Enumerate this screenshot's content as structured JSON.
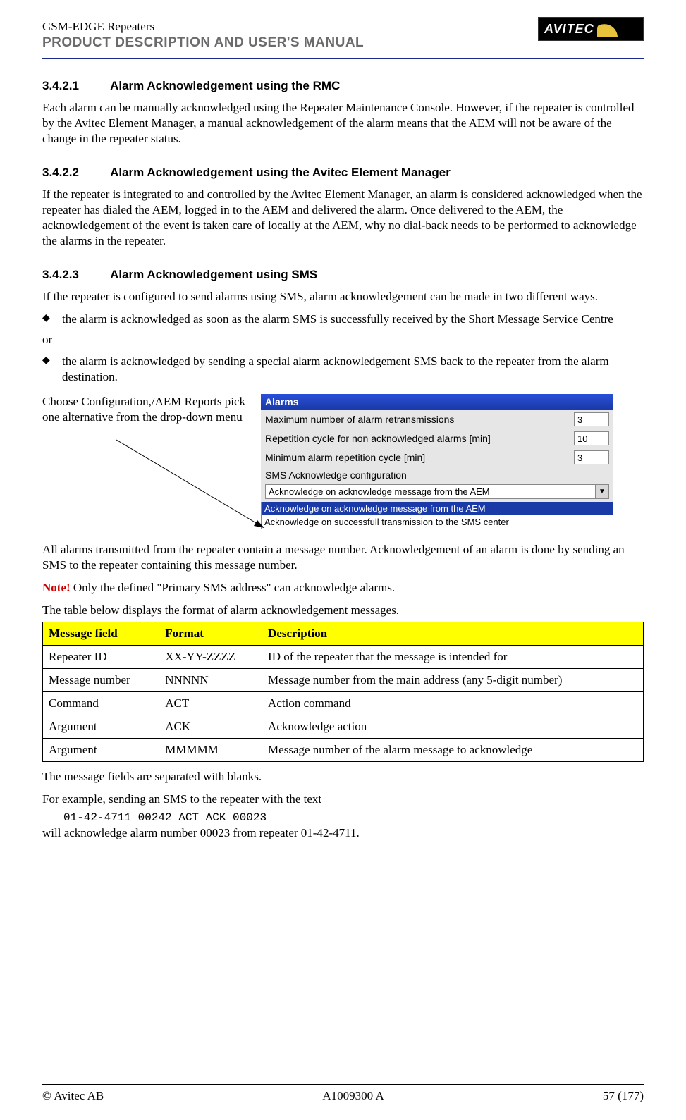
{
  "header": {
    "product_line": "GSM-EDGE Repeaters",
    "manual_title": "PRODUCT DESCRIPTION AND USER'S MANUAL",
    "logo_text": "AVITEC"
  },
  "sections": {
    "s1": {
      "num": "3.4.2.1",
      "title": "Alarm Acknowledgement using the RMC",
      "body": "Each alarm can be manually acknowledged using the Repeater Maintenance Console. However, if the repeater is controlled by the Avitec Element Manager, a manual acknowledgement of the alarm means that the AEM will not be aware of the change in the repeater status."
    },
    "s2": {
      "num": "3.4.2.2",
      "title": "Alarm Acknowledgement using the Avitec Element Manager",
      "body": "If the repeater is integrated to and controlled by the Avitec Element Manager, an alarm is considered acknowledged when the repeater has dialed the AEM, logged in to the AEM and delivered the alarm. Once delivered to the AEM, the acknowledgement of the event is taken care of locally at the AEM, why no dial-back needs to be performed to acknowledge the alarms in the repeater."
    },
    "s3": {
      "num": "3.4.2.3",
      "title": "Alarm Acknowledgement using SMS",
      "body_intro": "If the repeater is configured to send alarms using SMS, alarm acknowledgement can be made in two different ways.",
      "bullet1": "the alarm is acknowledged as soon as the alarm SMS is successfully received by the Short Message Service Centre",
      "or": "or",
      "bullet2": "the alarm is acknowledged by sending a special alarm acknowledgement SMS back to the repeater from the alarm destination.",
      "choose_text": "Choose Configuration,/AEM Reports pick one alternative from the drop-down menu",
      "after_fig_1": "All alarms transmitted from the repeater contain a message number. Acknowledgement of an alarm is done by sending an SMS to the repeater containing this message number.",
      "note_label": "Note!",
      "note_body": " Only the defined \"Primary SMS address\" can acknowledge alarms.",
      "table_intro": "The table below displays the format of alarm acknowledgement messages.",
      "after_table_1": "The message fields are separated with blanks.",
      "after_table_2": "For example, sending an SMS to the repeater with the text",
      "code_line": "01-42-4711 00242 ACT ACK 00023",
      "after_table_3": "will acknowledge alarm number 00023 from repeater 01-42-4711."
    }
  },
  "figure": {
    "title": "Alarms",
    "rows": [
      {
        "label": "Maximum number of alarm retransmissions",
        "value": "3"
      },
      {
        "label": "Repetition cycle for non acknowledged alarms [min]",
        "value": "10"
      },
      {
        "label": "Minimum alarm repetition cycle [min]",
        "value": "3"
      }
    ],
    "group_label": "SMS Acknowledge configuration",
    "select_value": "Acknowledge on acknowledge message from the AEM",
    "options": [
      "Acknowledge on acknowledge message from the AEM",
      "Acknowledge on successfull transmission to the SMS center"
    ]
  },
  "table": {
    "headers": [
      "Message field",
      "Format",
      "Description"
    ],
    "rows": [
      [
        "Repeater ID",
        "XX-YY-ZZZZ",
        "ID of the repeater that the message is intended for"
      ],
      [
        "Message number",
        "NNNNN",
        "Message number from the main address (any 5-digit number)"
      ],
      [
        "Command",
        "ACT",
        "Action command"
      ],
      [
        "Argument",
        "ACK",
        "Acknowledge action"
      ],
      [
        "Argument",
        "MMMMM",
        "Message number of the alarm message to acknowledge"
      ]
    ]
  },
  "footer": {
    "left": "© Avitec AB",
    "center": "A1009300 A",
    "right": "57 (177)"
  }
}
